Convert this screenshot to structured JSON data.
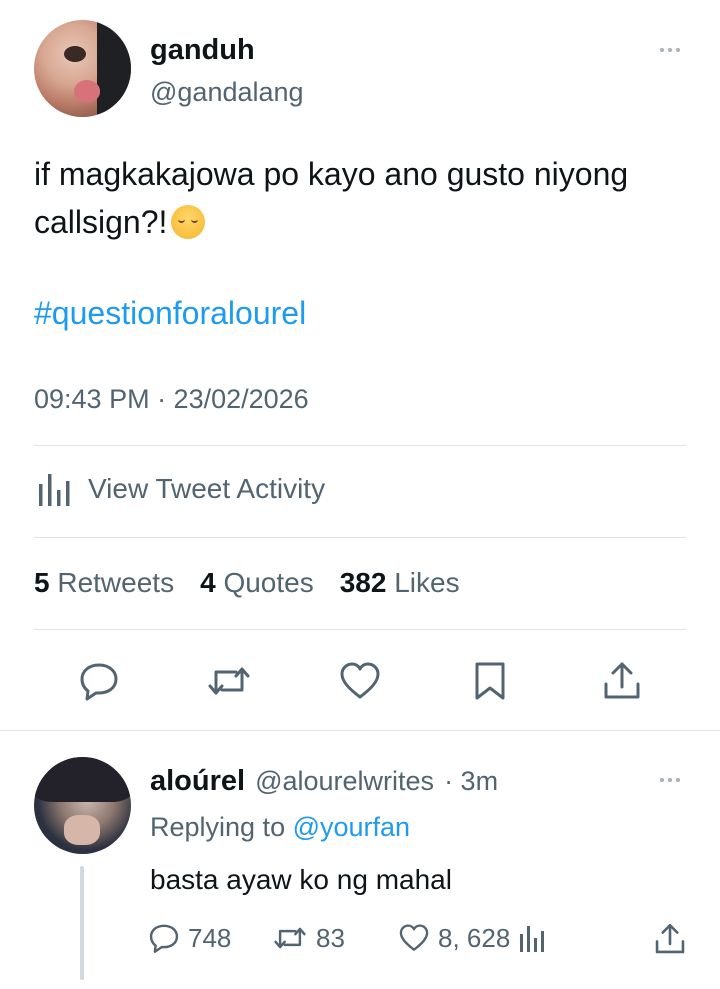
{
  "tweet": {
    "author_name": "ganduh",
    "author_handle": "@gandalang",
    "text": "if magkakajowa po kayo ano gusto niyong callsign?!",
    "hashtag": "#questionforalourel",
    "timestamp": "09:43 PM · 23/02/2026",
    "activity_label": "View Tweet Activity",
    "stats": {
      "retweets_count": "5",
      "retweets_label": "Retweets",
      "quotes_count": "4",
      "quotes_label": "Quotes",
      "likes_count": "382",
      "likes_label": "Likes"
    },
    "actions": [
      "reply-icon",
      "retweet-icon",
      "like-icon",
      "bookmark-icon",
      "share-icon"
    ]
  },
  "reply": {
    "author_name": "aloúrel",
    "author_handle": "@alourelwrites",
    "time": "· 3m",
    "replying_prefix": "Replying to",
    "replying_mention": "@yourfan",
    "text": "basta ayaw ko ng mahal",
    "replies": "748",
    "retweets": "83",
    "likes": "8, 628"
  },
  "colors": {
    "text": "#0f1419",
    "secondary": "#536471",
    "accent": "#1d9bf0",
    "divider": "#dfe3e6"
  }
}
